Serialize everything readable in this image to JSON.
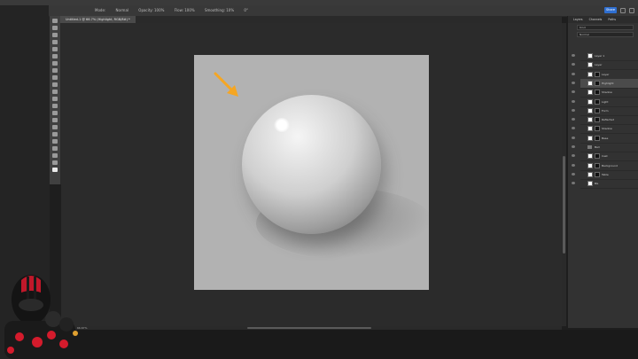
{
  "optionsbar": {
    "items": [
      "Mode:",
      "Normal",
      "Opacity: 100%",
      "Flow: 100%",
      "Smoothing: 10%",
      "0°"
    ],
    "share_label": "Share"
  },
  "document": {
    "tab_label": "Untitled-1 @ 66.7% (Highlight, RGB/8#) *"
  },
  "panels": {
    "tabs": [
      "Layers",
      "Channels",
      "Paths"
    ],
    "kind_label": "Kind",
    "blend_label": "Normal",
    "layers": [
      {
        "name": "Layer 1",
        "active": false,
        "mask": false
      },
      {
        "name": "Layer",
        "active": false,
        "mask": false
      },
      {
        "name": "Layer",
        "active": false,
        "mask": true
      },
      {
        "name": "Highlight",
        "active": true,
        "mask": true
      },
      {
        "name": "Shadow",
        "active": false,
        "mask": true
      },
      {
        "name": "Light",
        "active": false,
        "mask": true
      },
      {
        "name": "Form",
        "active": false,
        "mask": true
      },
      {
        "name": "Reflected",
        "active": false,
        "mask": true
      },
      {
        "name": "Shadow",
        "active": false,
        "mask": true
      },
      {
        "name": "Base",
        "active": false,
        "mask": true
      },
      {
        "name": "Ball",
        "active": false,
        "mask": false,
        "folder": true
      },
      {
        "name": "Cast",
        "active": false,
        "mask": true
      },
      {
        "name": "Background",
        "active": false,
        "mask": true
      },
      {
        "name": "Table",
        "active": false,
        "mask": true
      },
      {
        "name": "BG",
        "active": false,
        "mask": false
      }
    ]
  },
  "status": {
    "zoom": "66.67%"
  },
  "colors": {
    "accent": "#2f6fd1",
    "arrow": "#f5a623"
  },
  "icons": [
    "move-tool-icon",
    "brush-tool-icon",
    "eye-icon",
    "folder-icon",
    "arrow-annotation-icon"
  ]
}
